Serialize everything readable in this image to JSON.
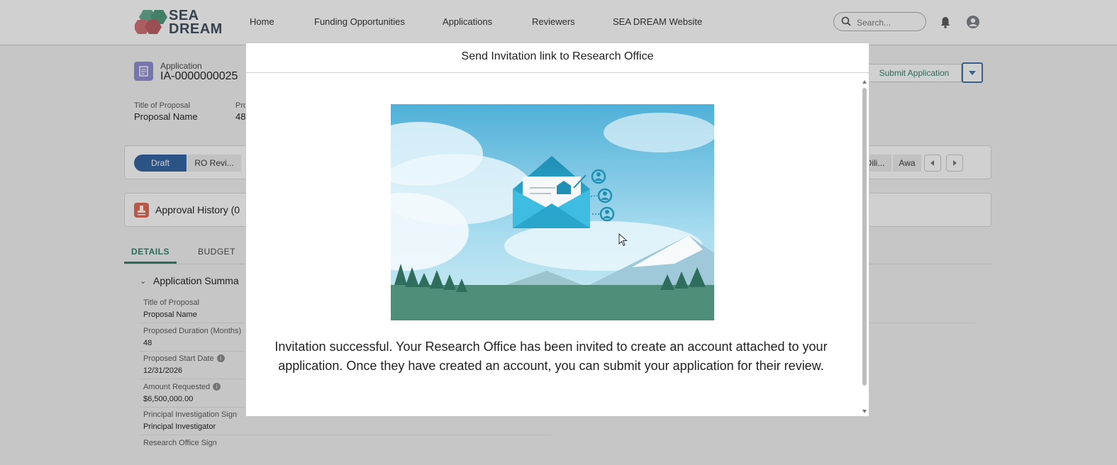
{
  "nav": {
    "logo_line1": "SEA",
    "logo_line2": "DREAM",
    "links": [
      "Home",
      "Funding Opportunities",
      "Applications",
      "Reviewers",
      "SEA DREAM Website"
    ],
    "search_placeholder": "Search...",
    "icons": {
      "search": "search-icon",
      "notifications": "bell-icon",
      "user": "user-avatar-icon"
    }
  },
  "record": {
    "type_label": "Application",
    "name": "IA-0000000025",
    "submit_button": "Submit Application",
    "highlights": [
      {
        "label": "Title of Proposal",
        "value": "Proposal Name"
      },
      {
        "label": "Pro",
        "value": "48"
      }
    ]
  },
  "path": {
    "stages_left": [
      "Draft",
      "RO Revi..."
    ],
    "stages_right": [
      "Dili...",
      "Awa"
    ],
    "active": "Draft"
  },
  "approval": {
    "title": "Approval History (0"
  },
  "tabs": [
    "DETAILS",
    "BUDGET"
  ],
  "details": {
    "section_title": "Application Summa",
    "fields": [
      {
        "label": "Title of Proposal",
        "value": "Proposal Name",
        "info": false
      },
      {
        "label": "Proposed Duration (Months)",
        "value": "48",
        "info": false
      },
      {
        "label": "Proposed Start Date",
        "value": "12/31/2026",
        "info": true
      },
      {
        "label": "Amount Requested",
        "value": "$6,500,000.00",
        "info": true
      },
      {
        "label": "Principal Investigation Sign",
        "value": "Principal Investigator",
        "info": false
      },
      {
        "label": "Research Office Sign",
        "value": "",
        "info": false
      }
    ]
  },
  "modal": {
    "title": "Send Invitation link to Research Office",
    "message": "Invitation successful. Your Research Office has been invited to create an account attached to your application. Once they have created an account, you can submit your application for their review.",
    "illustration": "invitation-envelope-illustration"
  },
  "colors": {
    "brand_green": "#2e7d69",
    "path_active": "#2e5fa0",
    "record_icon": "#8d8bd6",
    "approval_icon": "#e0674f"
  }
}
